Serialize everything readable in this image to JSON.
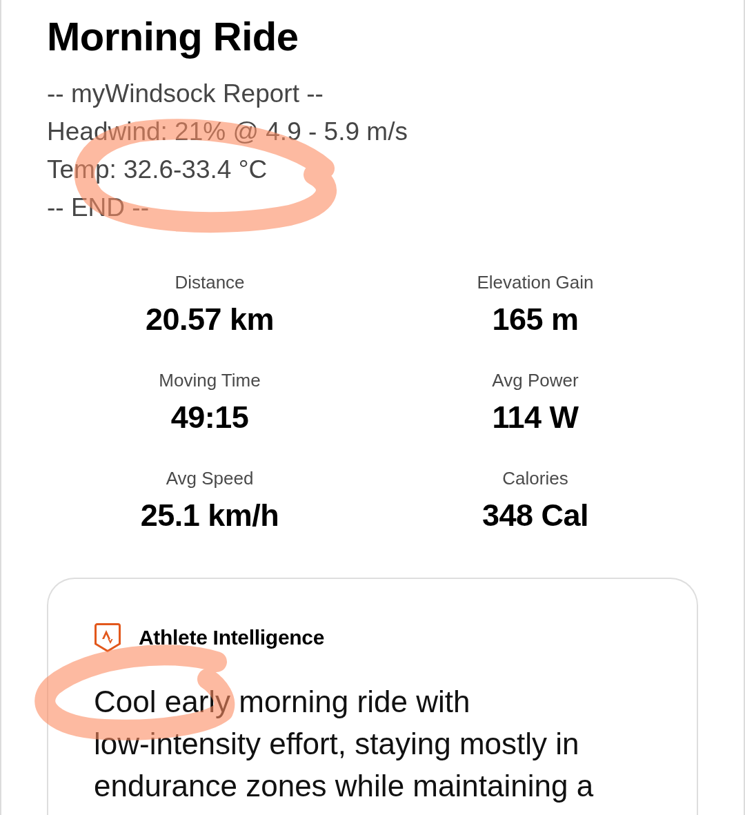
{
  "activity": {
    "title": "Morning Ride",
    "description": [
      {
        "text": "-- myWindsock Report --",
        "circled": false
      },
      {
        "text": "Headwind: 21% @ 4.9 - 5.9 m/s",
        "circled": false
      },
      {
        "text": "Temp: 32.6-33.4 °C",
        "circled": true
      },
      {
        "text": "-- END --",
        "circled": false
      }
    ]
  },
  "stats": [
    {
      "label": "Distance",
      "value": "20.57 km"
    },
    {
      "label": "Elevation Gain",
      "value": "165 m"
    },
    {
      "label": "Moving Time",
      "value": "49:15"
    },
    {
      "label": "Avg Power",
      "value": "114 W"
    },
    {
      "label": "Avg Speed",
      "value": "25.1 km/h"
    },
    {
      "label": "Calories",
      "value": "348 Cal"
    }
  ],
  "insight": {
    "title": "Athlete Intelligence",
    "text": "Cool early morning ride with low-intensity effort, staying mostly in endurance zones while maintaining a",
    "circled": true
  }
}
